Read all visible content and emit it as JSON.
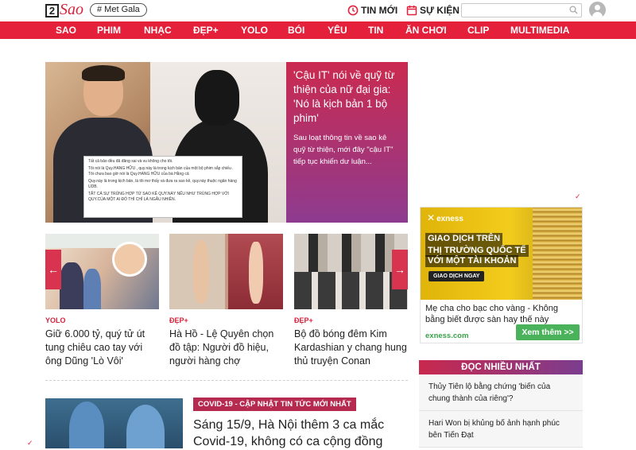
{
  "header": {
    "logo_number": "2",
    "logo_word": "Sao",
    "tag": "# Met Gala",
    "links": [
      "TIN MỚI",
      "SỰ KIỆN"
    ],
    "search_placeholder": ""
  },
  "nav": {
    "items": [
      "SAO",
      "PHIM",
      "NHẠC",
      "ĐẸP+",
      "YOLO",
      "BÓI",
      "YÊU",
      "TIN",
      "ĂN CHƠI",
      "CLIP",
      "MULTIMEDIA"
    ]
  },
  "hero": {
    "title": "'Cậu IT' nói về quỹ từ thiện của nữ đại gia: 'Nó là kịch bản 1 bộ phim'",
    "sapo": "Sau loạt thông tin về sao kê quỹ từ thiện, mới đây \"cậu IT\" tiếp tục khiến dư luận...",
    "note_lines": [
      "Tất cả bảo đều đã đăng sai và vu không cho tôi.",
      "Tôi nói là Quy.HANG HỮU , quy.này là trong kịch bản của một bộ phim sắp chiếu . Tôi chưa bao giờ nói là Quy.HANG HỮU của bà Hằng cả",
      "Quy.này là trong kịch bản, là tôi mơ thấy và đưa ra sao kê, quy.này thuộc ngân hàng UDB.",
      "TẤT CẢ SỰ TRÙNG HỢP TỪ SAO KÊ QUY.NÀY NẾU NHƯ TRÙNG HỢP VỚI QUY.CỦA MỘT AI ĐÓ THÌ CHỈ LÀ NGẪU NHIÊN."
    ]
  },
  "cards": [
    {
      "category": "YOLO",
      "title": "Giữ 6.000 tỷ, quý tử út tung chiêu cao tay với ông Dũng 'Lò Vôi'"
    },
    {
      "category": "ĐẸP+",
      "title": "Hà Hồ - Lệ Quyên chọn đồ tập: Người đồ hiệu, người hàng chợ"
    },
    {
      "category": "ĐẸP+",
      "title": "Bộ đồ bóng đêm Kim Kardashian y chang hung thủ truyện Conan"
    }
  ],
  "covid": {
    "badge": "COVID-19 - CẬP NHẬT TIN TỨC MỚI NHẤT",
    "title": "Sáng 15/9, Hà Nội thêm 3 ca mắc Covid-19, không có ca cộng đồng"
  },
  "ad": {
    "brand": "exness",
    "headline_1": "GIAO DỊCH TRÊN",
    "headline_2": "THỊ TRƯỜNG QUỐC TẾ",
    "headline_3": "VỚI MỘT TÀI KHOẢN",
    "cta": "GIAO DỊCH NGAY",
    "text": "Mẹ cha cho bạc cho vàng - Không bằng biết được sàn hay thế này",
    "domain": "exness.com",
    "button": "Xem thêm  >>"
  },
  "popular": {
    "heading": "ĐỌC NHIỀU NHẤT",
    "items": [
      "Thủy Tiên lộ bằng chứng 'biến của chung thành của riêng'?",
      "Hari Won bị khủng bố ảnh hạnh phúc bên Tiến Đạt"
    ]
  },
  "colors": {
    "brand_red": "#e4203b",
    "panel_gradient_start": "#cb2a4f",
    "panel_gradient_end": "#8d3b90",
    "ad_green": "#4ab25a"
  }
}
